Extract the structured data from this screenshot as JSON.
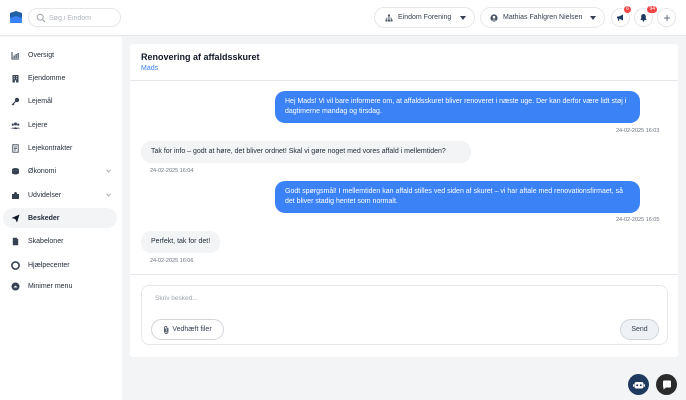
{
  "header": {
    "search_placeholder": "Søg i Eindom",
    "org_selector": "Eindom Forening",
    "user_selector": "Mathias Fahlgren Nielsen",
    "announcements_badge": "6",
    "notifications_badge": "94"
  },
  "sidebar": {
    "items": [
      {
        "label": "Oversigt",
        "icon": "chart-icon"
      },
      {
        "label": "Ejendomme",
        "icon": "building-icon"
      },
      {
        "label": "Lejemål",
        "icon": "key-icon"
      },
      {
        "label": "Lejere",
        "icon": "users-icon"
      },
      {
        "label": "Lejekontrakter",
        "icon": "document-icon"
      },
      {
        "label": "Økonomi",
        "icon": "coins-icon"
      },
      {
        "label": "Udvidelser",
        "icon": "puzzle-icon"
      },
      {
        "label": "Beskeder",
        "icon": "paper-plane-icon"
      },
      {
        "label": "Skabeloner",
        "icon": "file-icon"
      },
      {
        "label": "Hjælpecenter",
        "icon": "lifebuoy-icon"
      },
      {
        "label": "Minimer menu",
        "icon": "collapse-icon"
      }
    ]
  },
  "conversation": {
    "title": "Renovering af affaldsskuret",
    "participant": "Mads",
    "messages": [
      {
        "direction": "out",
        "text": "Hej Mads! Vi vil bare informere om, at affaldsskuret bliver renoveret i næste uge. Der kan derfor være lidt støj i dagtimerne mandag og tirsdag.",
        "time": "24-02-2025 16:03"
      },
      {
        "direction": "in",
        "text": "Tak for info – godt at høre, det bliver ordnet! Skal vi gøre noget med vores affald i mellemtiden?",
        "time": "24-02-2025 16:04"
      },
      {
        "direction": "out",
        "text": "Godt spørgsmål! I mellemtiden kan affald stilles ved siden af skuret – vi har aftale med renovationsfirmaet, så det bliver stadig hentet som normalt.",
        "time": "24-02-2025 16:05"
      },
      {
        "direction": "in",
        "text": "Perfekt, tak for det!",
        "time": "24-02-2025 16:06"
      }
    ]
  },
  "composer": {
    "placeholder": "Skriv besked...",
    "attach_label": "Vedhæft filer",
    "send_label": "Send"
  },
  "colors": {
    "accent": "#3b82f6",
    "badge": "#ef4444",
    "logo": "#1e5fa8"
  }
}
